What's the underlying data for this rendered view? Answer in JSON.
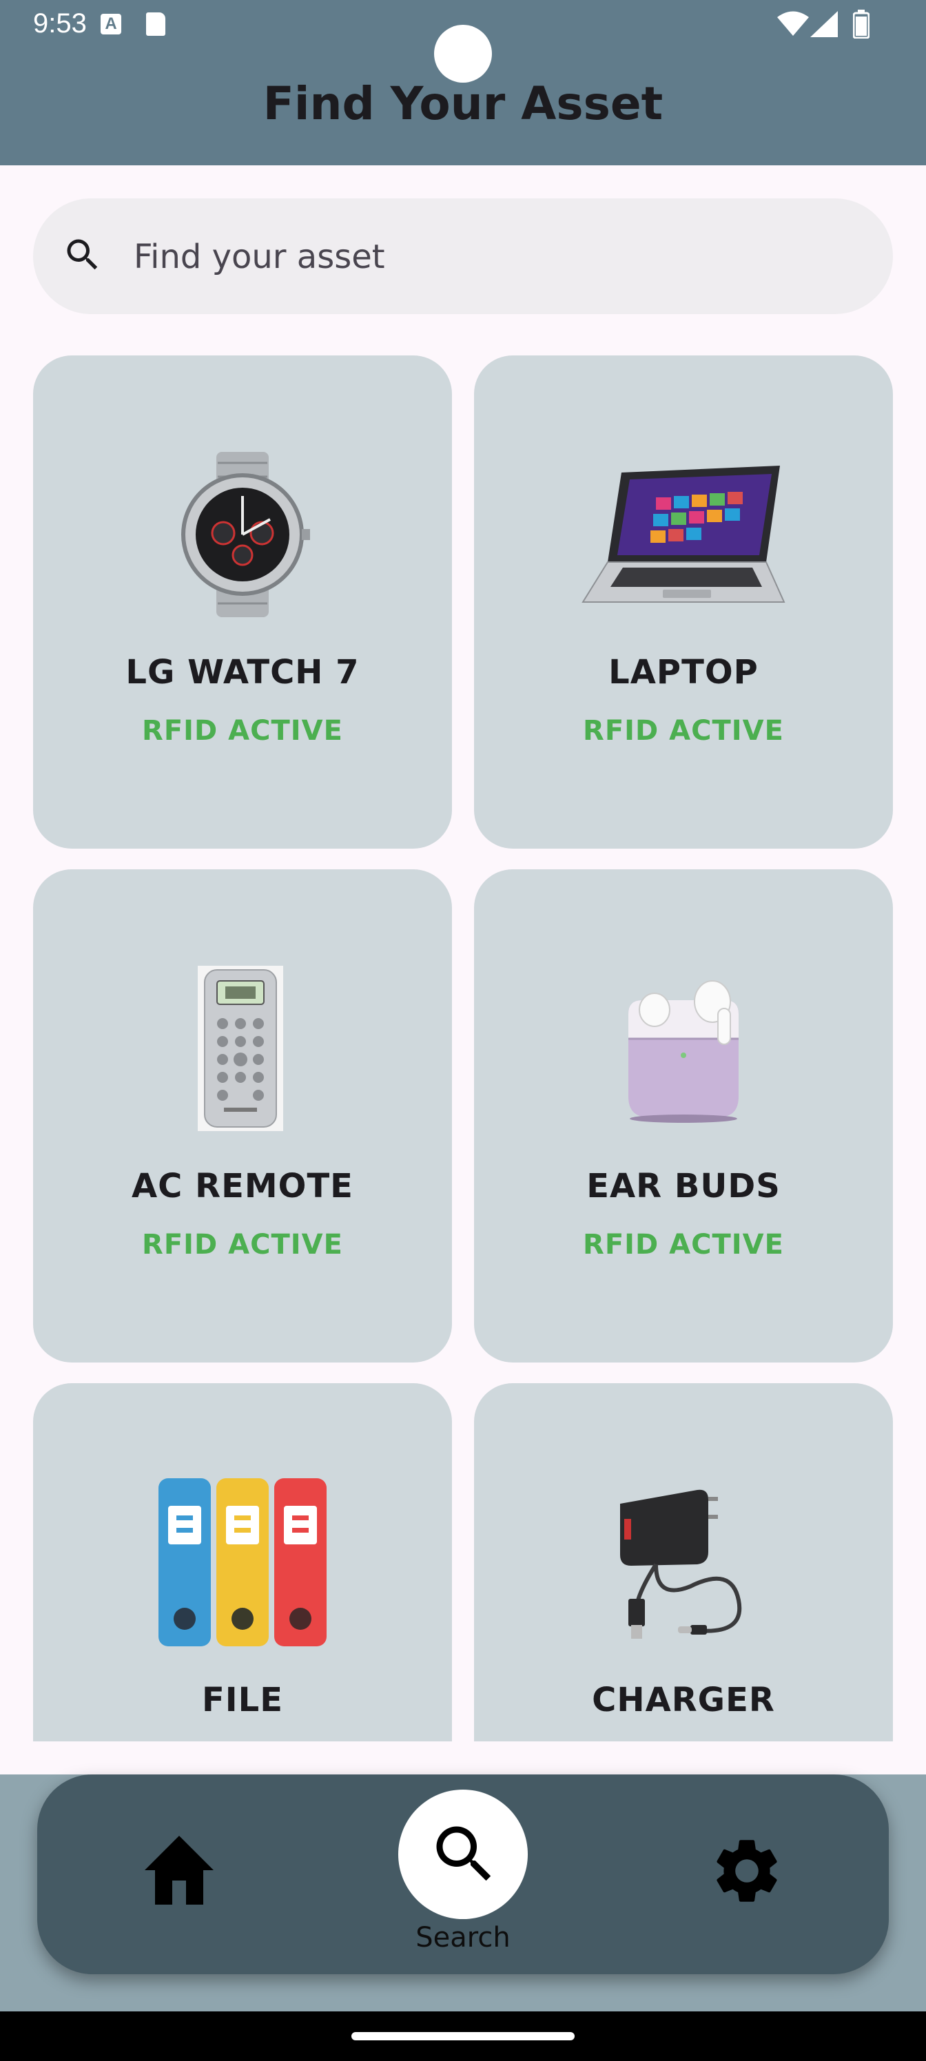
{
  "status_bar": {
    "time": "9:53"
  },
  "header": {
    "title": "Find Your Asset"
  },
  "search": {
    "placeholder": "Find your asset"
  },
  "assets": [
    {
      "name": "LG WATCH 7",
      "status": "RFID ACTIVE",
      "icon": "watch"
    },
    {
      "name": "LAPTOP",
      "status": "RFID ACTIVE",
      "icon": "laptop"
    },
    {
      "name": "AC REMOTE",
      "status": "RFID ACTIVE",
      "icon": "remote"
    },
    {
      "name": "EAR BUDS",
      "status": "RFID ACTIVE",
      "icon": "earbuds"
    },
    {
      "name": "FILE",
      "status": "",
      "icon": "folders"
    },
    {
      "name": "CHARGER",
      "status": "",
      "icon": "charger"
    }
  ],
  "bottom_nav": {
    "items": [
      {
        "icon": "home-icon"
      },
      {
        "icon": "search-icon",
        "label": "Search",
        "selected": true
      },
      {
        "icon": "settings-icon"
      }
    ]
  },
  "colors": {
    "appbar": "#617c8b",
    "card": "#cfd8dc",
    "status_active": "#4caf50",
    "navbar": "#455a64"
  }
}
